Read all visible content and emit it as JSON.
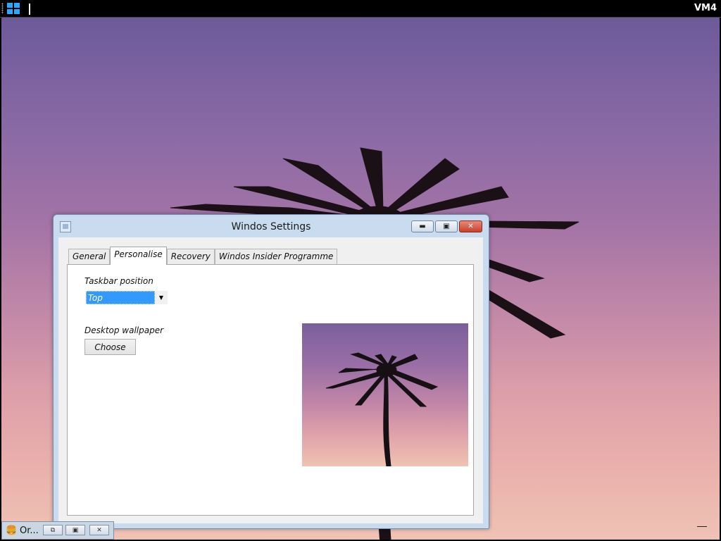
{
  "taskbar": {
    "start_icon": "windows-logo-icon",
    "vm_label": "VM4"
  },
  "window": {
    "title": "Windos Settings",
    "tabs": [
      {
        "label": "General"
      },
      {
        "label": "Personalise",
        "active": true
      },
      {
        "label": "Recovery"
      },
      {
        "label": "Windos Insider Programme"
      }
    ],
    "personalise": {
      "taskbar_position_label": "Taskbar position",
      "taskbar_position_value": "Top",
      "desktop_wallpaper_label": "Desktop wallpaper",
      "choose_label": "Choose"
    },
    "caption_icons": {
      "minimize": "minimize-icon",
      "maximize": "maximize-icon",
      "close": "close-icon"
    }
  },
  "minimized_app": {
    "icon": "burger-icon",
    "title": "Or..."
  },
  "colors": {
    "selection": "#3399ff",
    "close_button": "#c9402b"
  }
}
